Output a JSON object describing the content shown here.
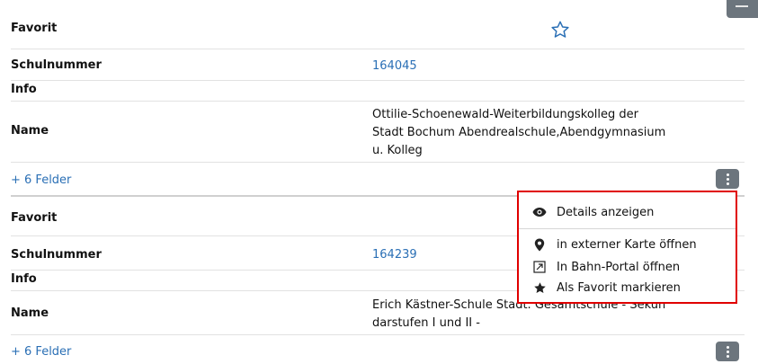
{
  "records": [
    {
      "favorit_label": "Favorit",
      "schulnummer_label": "Schulnummer",
      "schulnummer_value": "164045",
      "info_label": "Info",
      "name_label": "Name",
      "name_lines": [
        "Ottilie-Schoenewald-Weiterbildungskolleg der",
        "Stadt Bochum Abendrealschule,Abendgymnasium",
        "u. Kolleg"
      ],
      "more_fields": "+ 6 Felder"
    },
    {
      "favorit_label": "Favorit",
      "schulnummer_label": "Schulnummer",
      "schulnummer_value": "164239",
      "info_label": "Info",
      "name_label": "Name",
      "name_lines": [
        "Erich Kästner-Schule Stadt. Gesamtschule - Sekun",
        "darstufen I und II -"
      ],
      "more_fields": "+ 6 Felder"
    }
  ],
  "menu": {
    "items": [
      {
        "label": "Details anzeigen",
        "icon": "eye-icon"
      },
      {
        "label": "in externer Karte öffnen",
        "icon": "map-marker-icon"
      },
      {
        "label": "In Bahn-Portal öffnen",
        "icon": "external-portal-icon"
      },
      {
        "label": "Als Favorit markieren",
        "icon": "star-filled-icon"
      }
    ]
  },
  "colors": {
    "link": "#2a6fb5",
    "button": "#6c757d",
    "highlight": "#e00000"
  }
}
